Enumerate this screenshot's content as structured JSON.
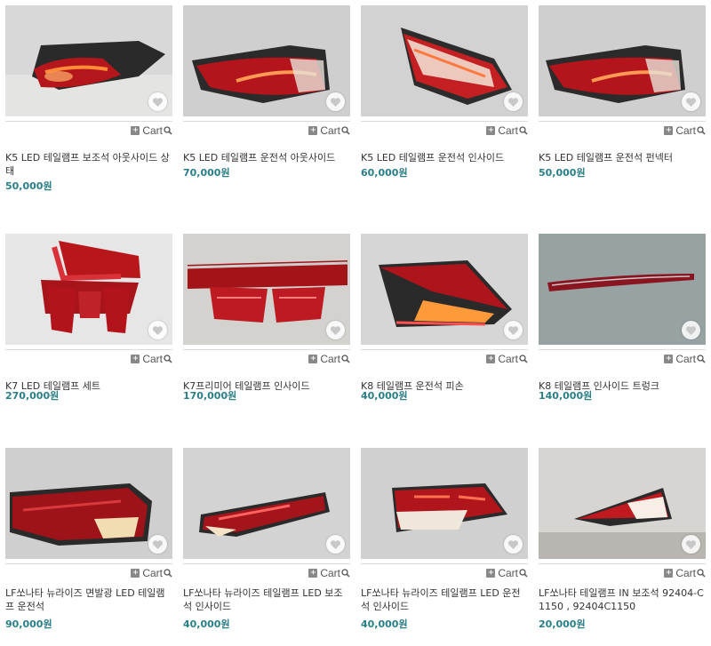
{
  "cart_label": "Cart",
  "products": [
    {
      "title": "K5 LED 테일램프 보조석 아웃사이드 상태",
      "price": "50,000원"
    },
    {
      "title": "K5 LED 테일램프 운전석 아웃사이드",
      "price": "70,000원"
    },
    {
      "title": "K5 LED 테일램프 운전석 인사이드",
      "price": "60,000원"
    },
    {
      "title": "K5 LED 테일램프 운전석 펀넥터",
      "price": "50,000원"
    },
    {
      "title": "K7 LED 테일램프 세트",
      "price": "270,000원"
    },
    {
      "title": "K7프리미어 테일램프 인사이드",
      "price": "170,000원"
    },
    {
      "title": "K8 테일램프 운전석 피손",
      "price": "40,000원"
    },
    {
      "title": "K8 테일램프 인사이드 트렁크",
      "price": "140,000원"
    },
    {
      "title": "LF쏘나타 뉴라이즈 면발광 LED 테일램프 운전석",
      "price": "90,000원"
    },
    {
      "title": "LF쏘나타 뉴라이즈 테일램프 LED 보조석 인사이드",
      "price": "40,000원"
    },
    {
      "title": "LF쏘나타 뉴라이즈 테일램프 LED 운전석 인사이드",
      "price": "40,000원"
    },
    {
      "title": "LF쏘나타 테일램프 IN 보조석 92404-C1150 , 92404C1150",
      "price": "20,000원"
    }
  ]
}
